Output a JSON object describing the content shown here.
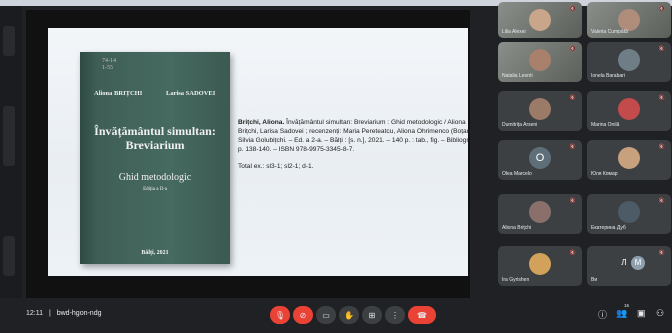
{
  "book": {
    "sticker": [
      "74-14",
      "1-55"
    ],
    "author_left": "Aliona BRIȚCHI",
    "author_right": "Larisa SADOVEI",
    "title": [
      "Învățământul simultan:",
      "Breviarium"
    ],
    "subtitle": "Ghid metodologic",
    "edition": "Ediția a II-a",
    "place": "Bălți, 2021"
  },
  "description": {
    "name": "Brițchi, Aliona.",
    "text": "Învățământul simultan: Breviarium : Ghid metodologic / Aliona Brițchi, Larisa Sadovei ; recenzenți: Maria Pereteatcu, Aliona Ohrimenco (Boțan), Silvia Golubițchi. – Ed. a 2-a. – Bălți : [s. n.], 2021. – 140 p. : tab., fig. – Bibliogr.: p. 138-140. – ISBN 978-9975-3345-8-7.",
    "total": "Total ex.: sl3-1; sl2-1; d-1."
  },
  "participants": [
    {
      "name": "Lilia Alexei",
      "kind": "photo",
      "avatar_color": "#c9a58a"
    },
    {
      "name": "Valeria Cumpătă",
      "kind": "photo",
      "avatar_color": "#b08d7a"
    },
    {
      "name": "Natalia Leonti",
      "kind": "photo",
      "avatar_color": "#a8806b"
    },
    {
      "name": "Ionela Barabari",
      "kind": "avatar",
      "avatar_color": "#6f7d86"
    },
    {
      "name": "Dumitrița Arseni",
      "kind": "avatar",
      "avatar_color": "#9b7a67"
    },
    {
      "name": "Marina Onilă",
      "kind": "avatar",
      "avatar_color": "#c44b4b"
    },
    {
      "name": "Olea Marcelo",
      "kind": "letter",
      "letter": "O",
      "avatar_color": "#5f6f7a"
    },
    {
      "name": "Юля Комар",
      "kind": "avatar",
      "avatar_color": "#c7a07d"
    },
    {
      "name": "Aliona Brițchi",
      "kind": "avatar",
      "avatar_color": "#8a6f6a"
    },
    {
      "name": "Екатерина Дуб",
      "kind": "avatar",
      "avatar_color": "#4c5b66"
    },
    {
      "name": "Ira Gyrishen",
      "kind": "avatar",
      "avatar_color": "#d2a25a"
    },
    {
      "name": "Ви",
      "kind": "group",
      "letters": [
        "Л",
        "M"
      ],
      "avatar_color": "#7a8f4a"
    }
  ],
  "meeting": {
    "time": "12:11",
    "separator": "|",
    "code": "bwd-hgon-ndg",
    "participant_count": "16"
  },
  "colors": {
    "danger": "#ea4335",
    "bar": "#202124",
    "tile": "#3c4043"
  }
}
